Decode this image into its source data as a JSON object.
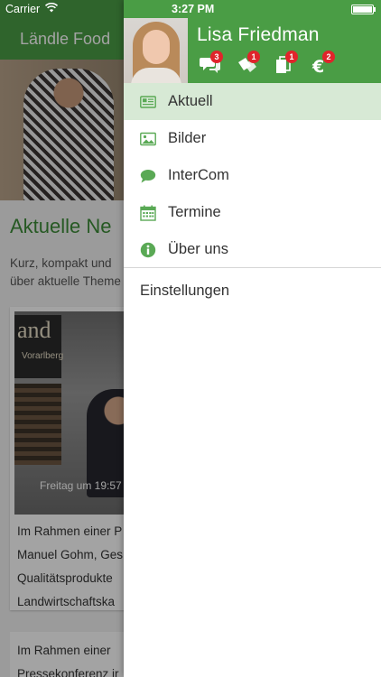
{
  "status_bar": {
    "carrier": "Carrier",
    "time": "3:27 PM"
  },
  "background": {
    "nav_title": "Ländle Food",
    "section_title": "Aktuelle Ne",
    "intro_lines": [
      "Kurz, kompakt und",
      "über aktuelle Theme"
    ],
    "card": {
      "banner_text": "and",
      "banner_sub": "Vorarlberg",
      "date": "Freitag um 19:57",
      "lines": [
        "Im Rahmen einer P",
        "Manuel Gohm, Ges",
        "Qualitätsprodukte",
        "Landwirtschaftska"
      ]
    },
    "card2_lines": [
      "Im Rahmen einer",
      "Pressekonferenz ir"
    ]
  },
  "drawer": {
    "user_name": "Lisa Friedman",
    "header_icons": [
      {
        "name": "chat-icon",
        "badge": "3"
      },
      {
        "name": "tags-icon",
        "badge": "1"
      },
      {
        "name": "documents-icon",
        "badge": "1"
      },
      {
        "name": "euro-icon",
        "badge": "2"
      }
    ],
    "menu": [
      {
        "label": "Aktuell",
        "icon": "newspaper-icon",
        "active": true
      },
      {
        "label": "Bilder",
        "icon": "image-icon",
        "active": false
      },
      {
        "label": "InterCom",
        "icon": "speech-bubble-icon",
        "active": false
      },
      {
        "label": "Termine",
        "icon": "calendar-icon",
        "active": false
      },
      {
        "label": "Über uns",
        "icon": "info-icon",
        "active": false
      }
    ],
    "settings_label": "Einstellungen"
  },
  "colors": {
    "brand_green": "#4a9d45",
    "active_row": "#d7e9d5",
    "badge_red": "#e0242b",
    "icon_green": "#5aa955"
  }
}
